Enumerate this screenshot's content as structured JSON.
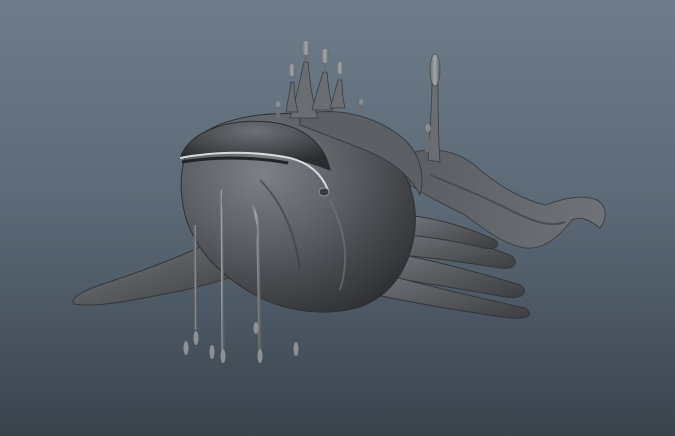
{
  "viewport": {
    "background_top": "#6e7c8a",
    "background_bottom": "#3a434c"
  },
  "model": {
    "shading_color": "#5a5d60",
    "highlight_color": "#8a8d90",
    "shadow_color": "#2a2c2e"
  }
}
